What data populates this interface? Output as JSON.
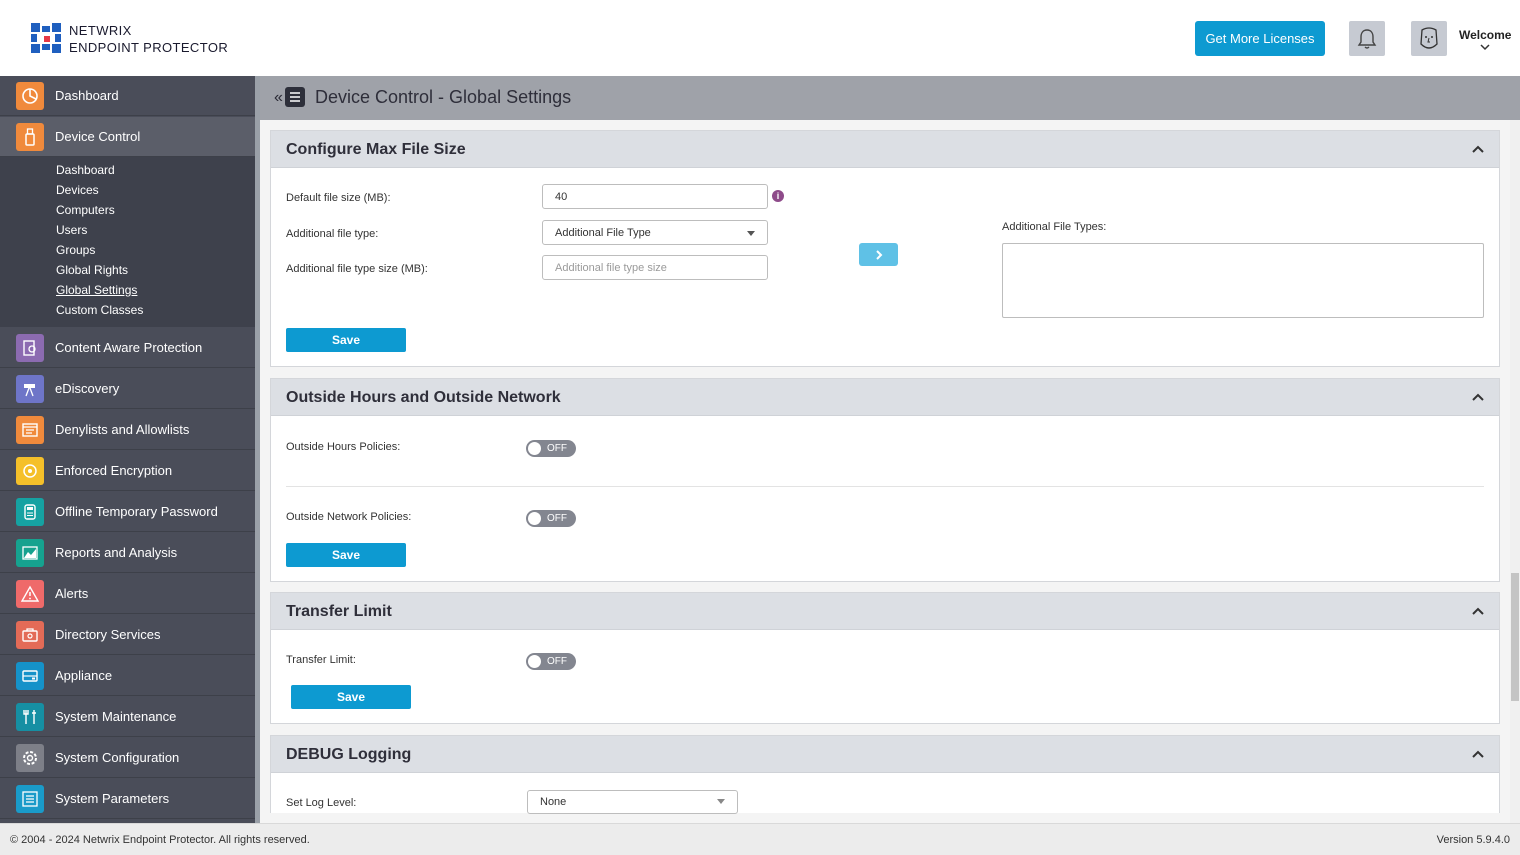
{
  "header": {
    "logo_line1": "NETWRIX",
    "logo_line2": "ENDPOINT PROTECTOR",
    "licenses_button": "Get More Licenses",
    "welcome": "Welcome"
  },
  "sidebar": {
    "items": [
      {
        "label": "Dashboard",
        "icon": "pie-chart-icon",
        "color": "#f08a3c"
      },
      {
        "label": "Device Control",
        "icon": "usb-icon",
        "color": "#f08a3c"
      },
      {
        "label": "Content Aware Protection",
        "icon": "document-search-icon",
        "color": "#8c6bb1"
      },
      {
        "label": "eDiscovery",
        "icon": "telescope-icon",
        "color": "#6e75c8"
      },
      {
        "label": "Denylists and Allowlists",
        "icon": "list-window-icon",
        "color": "#f08a3c"
      },
      {
        "label": "Enforced Encryption",
        "icon": "encryption-icon",
        "color": "#f5c02a"
      },
      {
        "label": "Offline Temporary Password",
        "icon": "device-password-icon",
        "color": "#16a2a2"
      },
      {
        "label": "Reports and Analysis",
        "icon": "chart-area-icon",
        "color": "#16a28f"
      },
      {
        "label": "Alerts",
        "icon": "warning-icon",
        "color": "#ef6a6a"
      },
      {
        "label": "Directory Services",
        "icon": "briefcase-icon",
        "color": "#e36b57"
      },
      {
        "label": "Appliance",
        "icon": "server-icon",
        "color": "#1592c9"
      },
      {
        "label": "System Maintenance",
        "icon": "tools-icon",
        "color": "#168fa3"
      },
      {
        "label": "System Configuration",
        "icon": "gear-icon",
        "color": "#7d7f88"
      },
      {
        "label": "System Parameters",
        "icon": "list-icon",
        "color": "#1a9bc9"
      }
    ],
    "subitems": [
      "Dashboard",
      "Devices",
      "Computers",
      "Users",
      "Groups",
      "Global Rights",
      "Global Settings",
      "Custom Classes"
    ]
  },
  "page": {
    "title": "Device Control - Global Settings"
  },
  "max_file_size": {
    "title": "Configure Max File Size",
    "default_label": "Default file size (MB):",
    "default_value": "40",
    "type_label": "Additional file type:",
    "type_value": "Additional File Type",
    "type_size_label": "Additional file type size (MB):",
    "type_size_placeholder": "Additional file type size",
    "types_list_label": "Additional File Types:",
    "save": "Save"
  },
  "outside": {
    "title": "Outside Hours and Outside Network",
    "hours_label": "Outside Hours Policies:",
    "hours_state": "OFF",
    "network_label": "Outside Network Policies:",
    "network_state": "OFF",
    "save": "Save"
  },
  "transfer": {
    "title": "Transfer Limit",
    "label": "Transfer Limit:",
    "state": "OFF",
    "save": "Save"
  },
  "debug": {
    "title": "DEBUG Logging",
    "label": "Set Log Level:",
    "value": "None"
  },
  "footer": {
    "copyright": "© 2004 - 2024 Netwrix Endpoint Protector. All rights reserved.",
    "version": "Version 5.9.4.0"
  }
}
